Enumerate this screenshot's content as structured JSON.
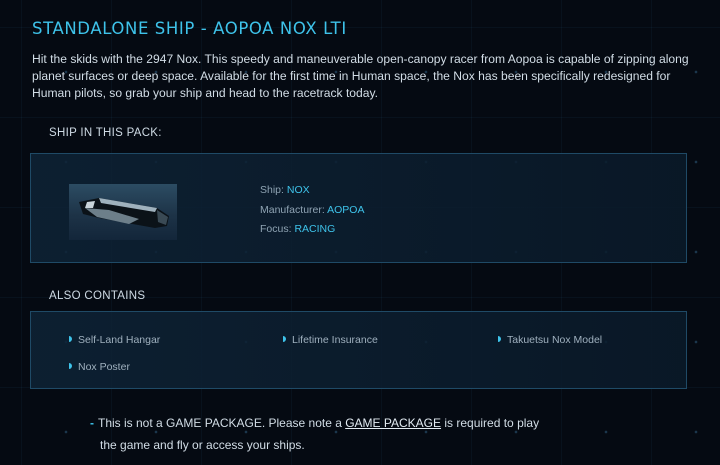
{
  "title": "STANDALONE SHIP - AOPOA NOX LTI",
  "description": "Hit the skids with the 2947 Nox. This speedy and maneuverable open-canopy racer from Aopoa is capable of zipping along planet surfaces or deep space. Available for the first time in Human space, the Nox has been specifically redesigned for Human pilots, so grab your ship and head to the racetrack today.",
  "ship_section": {
    "label": "SHIP IN THIS PACK:",
    "image_icon": "ship-image",
    "specs": [
      {
        "key": "Ship: ",
        "value": "NOX"
      },
      {
        "key": "Manufacturer: ",
        "value": "AOPOA"
      },
      {
        "key": "Focus: ",
        "value": "RACING"
      }
    ]
  },
  "contains_section": {
    "label": "ALSO CONTAINS",
    "items": [
      "Self-Land Hangar",
      "Lifetime Insurance",
      "Takuetsu Nox Model",
      "Nox Poster"
    ]
  },
  "note": {
    "prefix": "This is not a GAME PACKAGE. Please note a ",
    "link": "GAME PACKAGE",
    "suffix": " is required to play",
    "line2": "the game and fly or access your ships."
  },
  "colors": {
    "accent": "#3ec3ea",
    "background": "#050a12",
    "panel_border": "#1f4a66"
  }
}
